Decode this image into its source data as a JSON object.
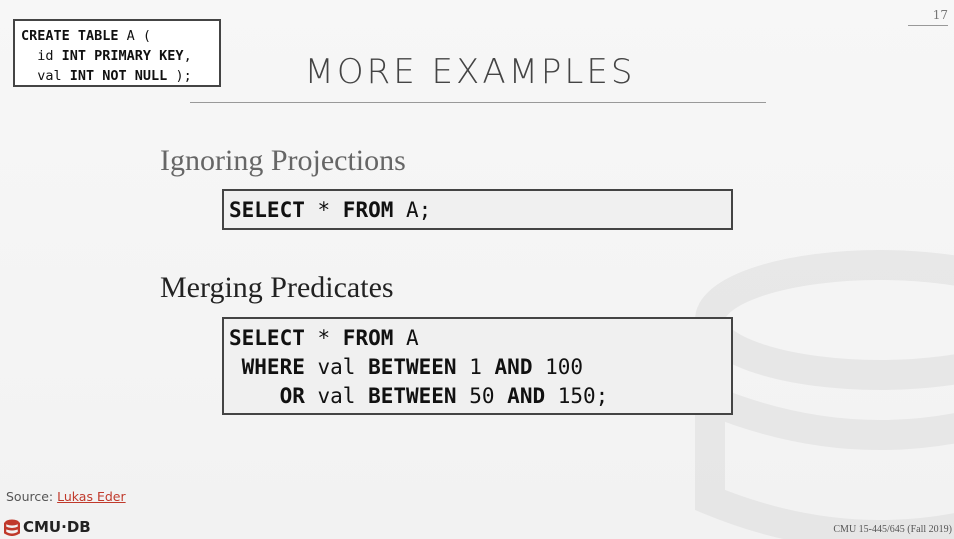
{
  "page_number": "17",
  "schema_box": {
    "line1": [
      "CREATE TABLE",
      " A ("
    ],
    "line2": [
      "  id ",
      "INT PRIMARY KEY",
      ","
    ],
    "line3": [
      "  val ",
      "INT NOT NULL",
      " );"
    ]
  },
  "title": "MORE EXAMPLES",
  "sections": [
    {
      "heading": "Ignoring Projections",
      "code": {
        "line1": [
          "SELECT",
          " * ",
          "FROM",
          " A;"
        ]
      }
    },
    {
      "heading": "Merging Predicates",
      "code": {
        "line1": [
          "SELECT",
          " * ",
          "FROM",
          " A"
        ],
        "line2": [
          " WHERE",
          " val ",
          "BETWEEN",
          " 1 ",
          "AND",
          " 100"
        ],
        "line3": [
          "    OR",
          " val ",
          "BETWEEN",
          " 50 ",
          "AND",
          " 150;"
        ]
      }
    }
  ],
  "source": {
    "prefix": "Source: ",
    "link_text": "Lukas Eder"
  },
  "logo": {
    "text": "CMU·DB",
    "icon": "database-logo-icon",
    "color": "#c0392b"
  },
  "footer": "CMU 15-445/645 (Fall 2019)"
}
